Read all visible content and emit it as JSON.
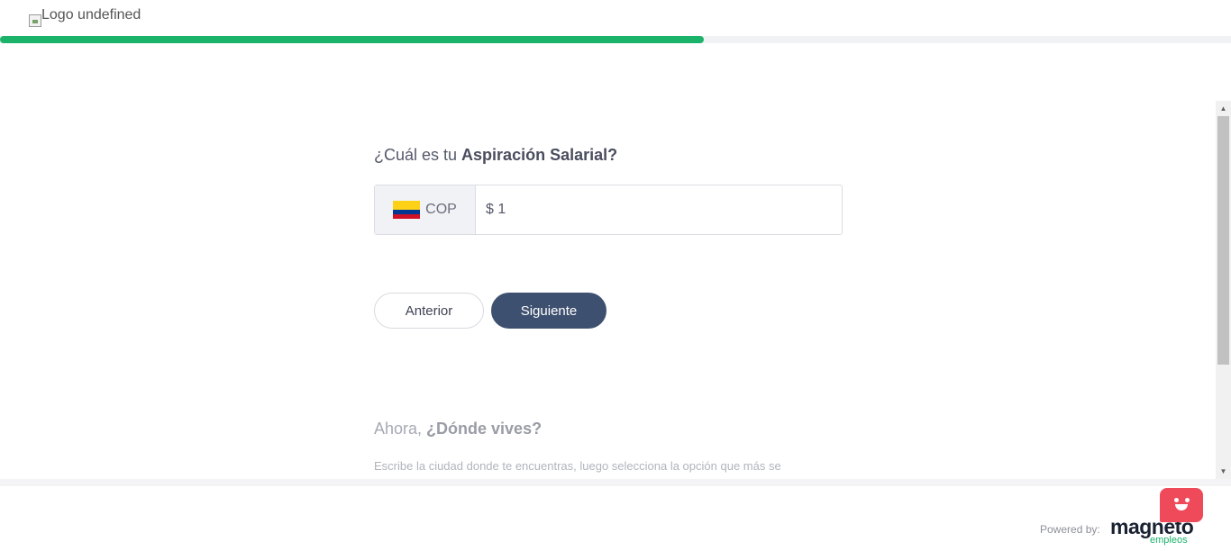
{
  "header": {
    "logo_alt": "Logo undefined",
    "progress_fraction": 0.5717
  },
  "main": {
    "question_prefix": "¿Cuál es tu ",
    "question_bold": "Aspiración Salarial?",
    "currency": {
      "flag": "colombia-flag",
      "code": "COP"
    },
    "salary_value": "$ 1",
    "buttons": {
      "previous": "Anterior",
      "next": "Siguiente"
    },
    "next_question_prefix": "Ahora, ",
    "next_question_bold": "¿Dónde vives?",
    "next_hint": "Escribe la ciudad donde te encuentras, luego selecciona la opción que más se"
  },
  "footer": {
    "powered_by": "Powered by:",
    "brand_name": "magneto",
    "brand_sub": "empleos"
  },
  "colors": {
    "progress": "#1bb26a",
    "primary_button": "#3e5070",
    "chat_widget": "#ef4a5a"
  },
  "icons": {
    "broken_image": "broken-image-icon",
    "chat": "chat-bot-icon",
    "scroll_up": "scroll-up-arrow-icon",
    "scroll_down": "scroll-down-arrow-icon"
  }
}
